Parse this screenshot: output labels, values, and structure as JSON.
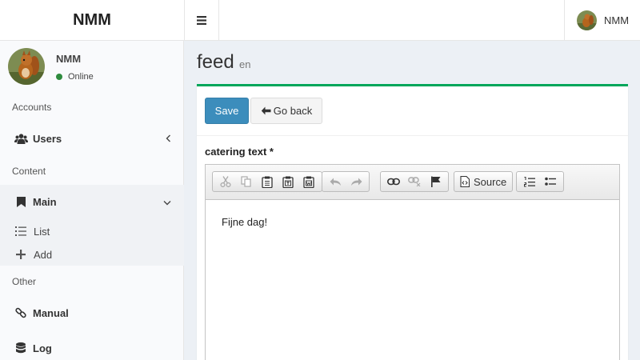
{
  "brand": {
    "logo_text": "NMM"
  },
  "topbar": {
    "user_name": "NMM"
  },
  "user_panel": {
    "name": "NMM",
    "status": "Online",
    "status_color": "#2e8b3e"
  },
  "sidebar": {
    "sections": [
      "Accounts",
      "Content",
      "Other"
    ],
    "items": [
      {
        "label": "Users",
        "icon": "users-icon"
      },
      {
        "label": "Main",
        "icon": "bookmark-icon"
      },
      {
        "label": "Manual",
        "icon": "link-icon"
      },
      {
        "label": "Log",
        "icon": "database-icon"
      }
    ],
    "sub_items": [
      {
        "label": "List",
        "icon": "list-icon"
      },
      {
        "label": "Add",
        "icon": "plus-icon"
      }
    ]
  },
  "page": {
    "title": "feed",
    "subtitle": "en"
  },
  "form": {
    "save_label": "Save",
    "back_label": "Go back",
    "field_label": "catering text *",
    "source_label": "Source",
    "editor_content": "Fijne dag!"
  },
  "colors": {
    "accent": "#3c8dbc",
    "box_border": "#00a65a"
  }
}
